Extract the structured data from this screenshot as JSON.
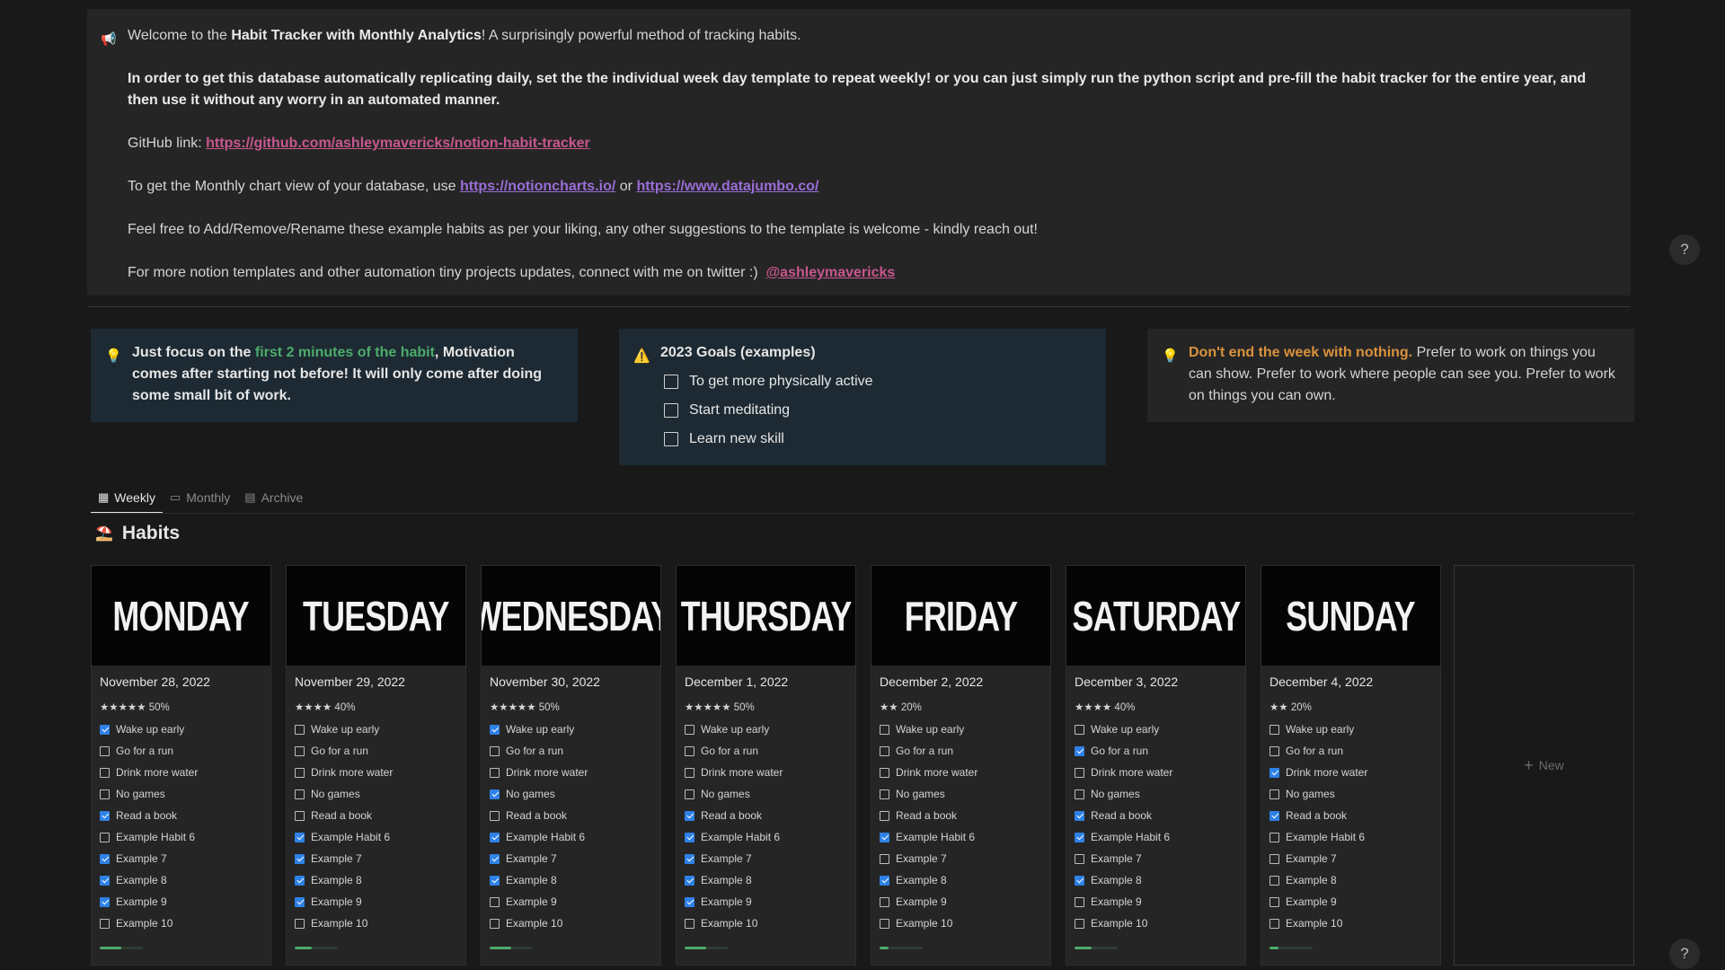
{
  "intro": {
    "welcome_pre": "Welcome to the ",
    "welcome_bold": "Habit Tracker with Monthly Analytics",
    "welcome_post": "! A surprisingly powerful method of tracking habits.",
    "instructions": "In order to get this database automatically replicating daily, set the the individual week day template to repeat weekly! or you can just simply run the python script and pre-fill the habit tracker for the entire year, and then use it without any worry in an automated manner.",
    "github_label": "GitHub link: ",
    "github_url": "https://github.com/ashleymavericks/notion-habit-tracker",
    "chart_pre": "To get the Monthly chart view of your database, use ",
    "chart_link1": "https://notioncharts.io/",
    "chart_or": " or ",
    "chart_link2": "https://www.datajumbo.co/",
    "feel_free": "Feel free to Add/Remove/Rename these example habits as per your liking, any other suggestions to the template is welcome - kindly reach out!",
    "twitter_pre": "For more notion templates and other automation tiny projects updates, connect with me on twitter :)  ",
    "twitter_handle": "@ashleymavericks"
  },
  "focus_callout": {
    "pre": "Just focus on the ",
    "highlight": "first 2 minutes of the habit",
    "post": ", Motivation comes after starting not before! It will only come after doing some small bit of work."
  },
  "goals": {
    "title": "2023 Goals (examples)",
    "items": [
      "To get more physically active",
      "Start meditating",
      "Learn new skill"
    ]
  },
  "week_callout": {
    "highlight": "Don't end the week with nothing.",
    "text": " Prefer to work on things you can show. Prefer to work where people can see you. Prefer to work on things you can own."
  },
  "tabs": [
    "Weekly",
    "Monthly",
    "Archive"
  ],
  "section_title": "Habits",
  "new_label": "New",
  "habit_names": [
    "Wake up early",
    "Go for a run",
    "Drink more water",
    "No games",
    "Read a book",
    "Example Habit 6",
    "Example 7",
    "Example 8",
    "Example 9",
    "Example 10"
  ],
  "days": [
    {
      "name": "MONDAY",
      "date": "November 28, 2022",
      "rating": "★★★★★ 50%",
      "progress": 0.5,
      "checks": [
        true,
        false,
        false,
        false,
        true,
        false,
        true,
        true,
        true,
        false
      ]
    },
    {
      "name": "TUESDAY",
      "date": "November 29, 2022",
      "rating": "★★★★ 40%",
      "progress": 0.4,
      "checks": [
        false,
        false,
        false,
        false,
        false,
        true,
        true,
        true,
        true,
        false
      ]
    },
    {
      "name": "WEDNESDAY",
      "date": "November 30, 2022",
      "rating": "★★★★★ 50%",
      "progress": 0.5,
      "checks": [
        true,
        false,
        false,
        true,
        false,
        true,
        true,
        true,
        false,
        false
      ]
    },
    {
      "name": "THURSDAY",
      "date": "December 1, 2022",
      "rating": "★★★★★ 50%",
      "progress": 0.5,
      "checks": [
        false,
        false,
        false,
        false,
        true,
        true,
        true,
        true,
        true,
        false
      ]
    },
    {
      "name": "FRIDAY",
      "date": "December 2, 2022",
      "rating": "★★ 20%",
      "progress": 0.2,
      "checks": [
        false,
        false,
        false,
        false,
        false,
        true,
        false,
        true,
        false,
        false
      ]
    },
    {
      "name": "SATURDAY",
      "date": "December 3, 2022",
      "rating": "★★★★ 40%",
      "progress": 0.4,
      "checks": [
        false,
        true,
        false,
        false,
        true,
        true,
        false,
        true,
        false,
        false
      ]
    },
    {
      "name": "SUNDAY",
      "date": "December 4, 2022",
      "rating": "★★ 20%",
      "progress": 0.2,
      "checks": [
        false,
        false,
        true,
        false,
        true,
        false,
        false,
        false,
        false,
        false
      ]
    }
  ],
  "colors": {
    "accent_link": "#c7578d",
    "link_purple": "#9a6dd7",
    "check_blue": "#2e81e6",
    "progress_green": "#4dab6b",
    "highlight_orange": "#d9923d"
  },
  "icons": {
    "announcement": "megaphone-icon",
    "tip": "lightbulb-icon",
    "warning": "warning-icon",
    "section": "beach-icon"
  },
  "help_label": "?"
}
